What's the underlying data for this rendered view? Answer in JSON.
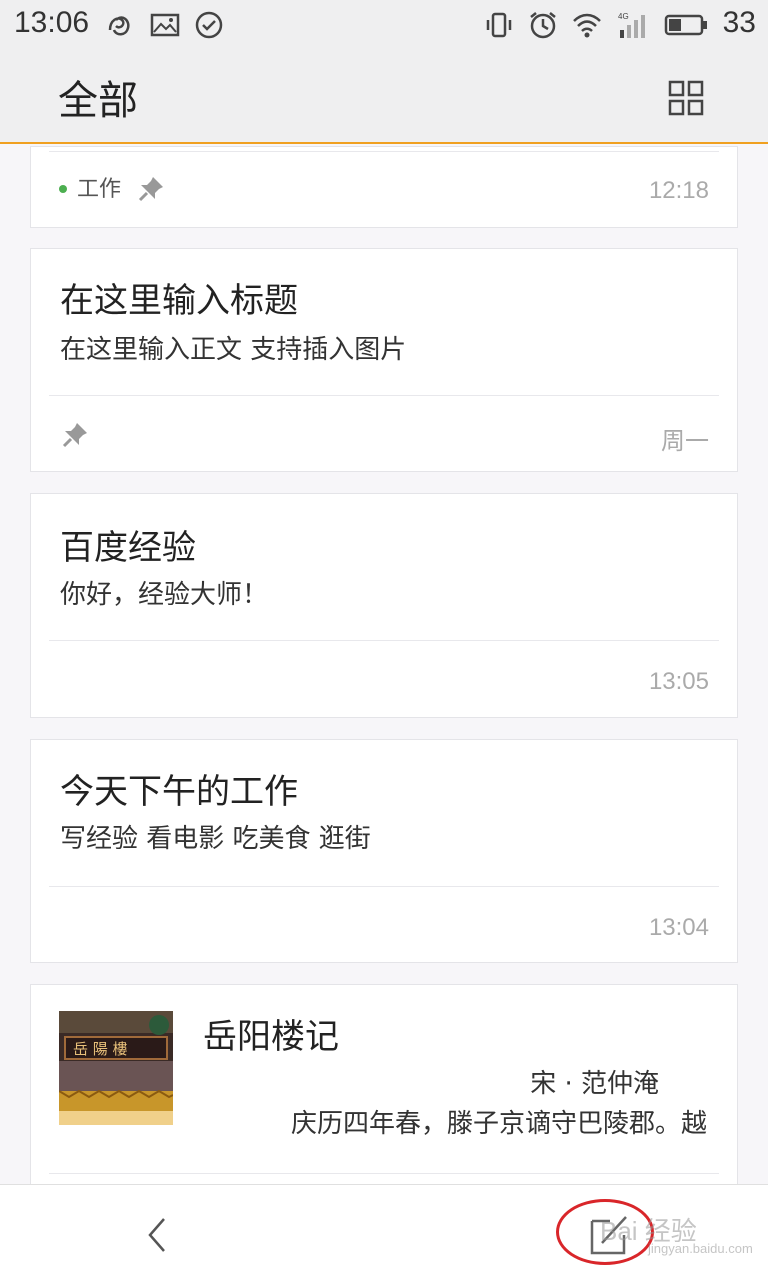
{
  "status_bar": {
    "time": "13:06",
    "battery": "33",
    "left_icons": [
      "swirl-icon",
      "image-icon",
      "check-circle-icon"
    ],
    "right_icons": [
      "vibrate-icon",
      "alarm-icon",
      "wifi-icon",
      "4g-signal-icon",
      "battery-icon"
    ]
  },
  "header": {
    "title": "全部",
    "grid_icon": "grid-view-icon"
  },
  "notes": [
    {
      "tag": "工作",
      "tag_color": "#4caf50",
      "time": "12:18",
      "pinned": true
    },
    {
      "title": "在这里输入标题",
      "body": "在这里输入正文  支持插入图片",
      "time": "周一",
      "pinned": true
    },
    {
      "title": "百度经验",
      "body": "你好，经验大师！",
      "time": "13:05"
    },
    {
      "title": "今天下午的工作",
      "body": "写经验 看电影 吃美食 逛街",
      "time": "13:04"
    },
    {
      "title": "岳阳楼记",
      "author": "宋 · 范仲淹",
      "excerpt": "庆历四年春，滕子京谪守巴陵郡。越"
    }
  ],
  "bottom_bar": {
    "back_icon": "chevron-left-icon",
    "edit_icon": "new-note-icon"
  },
  "colors": {
    "accent": "#f0a020",
    "highlight_circle": "#d9262a"
  }
}
